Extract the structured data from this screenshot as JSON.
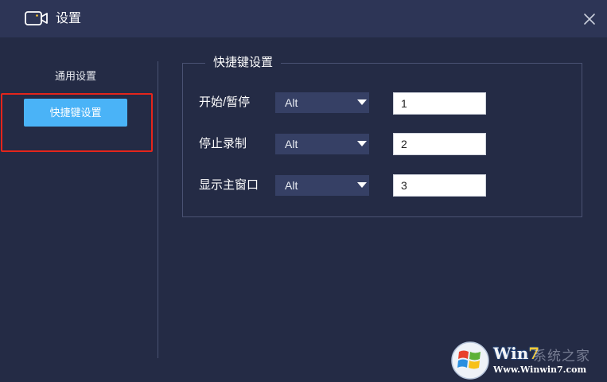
{
  "window": {
    "title": "设置",
    "icon": "video-camera-icon",
    "close_icon": "close-icon"
  },
  "sidebar": {
    "heading": "通用设置",
    "active_item": "快捷键设置"
  },
  "shortcut_group": {
    "legend": "快捷键设置",
    "rows": [
      {
        "label": "开始/暂停",
        "modifier": "Alt",
        "key": "1"
      },
      {
        "label": "停止录制",
        "modifier": "Alt",
        "key": "2"
      },
      {
        "label": "显示主窗口",
        "modifier": "Alt",
        "key": "3"
      }
    ]
  },
  "watermark": {
    "logo_text_win": "Win",
    "logo_text_seven": "7",
    "cn_text": "系统之家",
    "url": "Www.Winwin7.com"
  },
  "colors": {
    "background": "#242b45",
    "titlebar": "#2d3556",
    "accent": "#4ab3f7",
    "highlight": "#e4251b"
  }
}
